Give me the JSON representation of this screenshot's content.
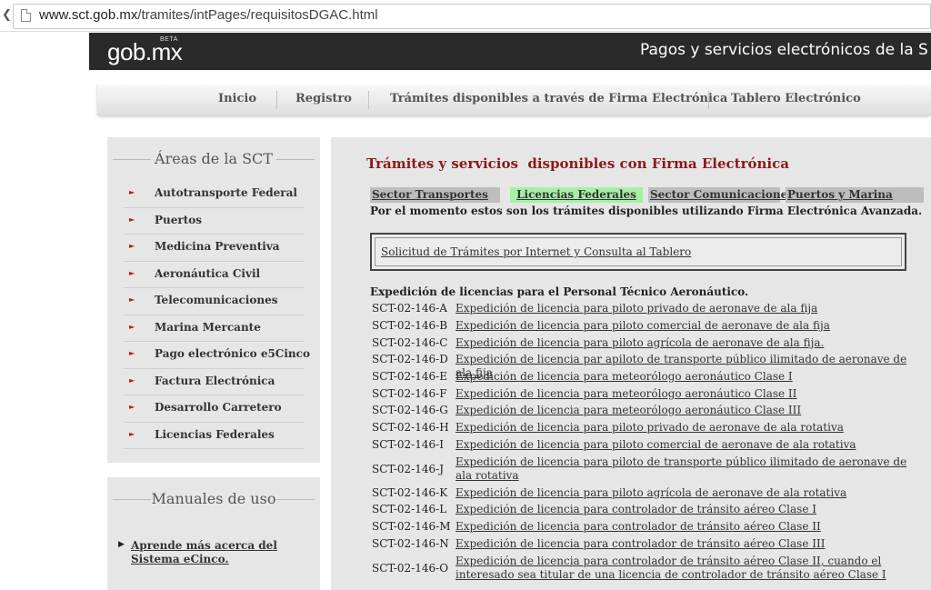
{
  "browser": {
    "url_host": "www.sct.gob.mx",
    "url_path": "/tramites/intPages/requisitosDGAC.html"
  },
  "header": {
    "logo": "gob.mx",
    "logo_badge": "BETA",
    "services_title": "Pagos y servicios electrónicos de la S"
  },
  "nav": {
    "items": [
      "Inicio",
      "Registro",
      "Trámites disponibles a través de Firma Electrónica",
      "Tablero Electrónico"
    ]
  },
  "sidebar": {
    "title": "Áreas de la SCT",
    "items": [
      "Autotransporte Federal",
      "Puertos",
      "Medicina Preventiva",
      "Aeronáutica Civil",
      "Telecomunicaciones",
      "Marina Mercante",
      "Pago electrónico e5Cinco",
      "Factura Electrónica",
      "Desarrollo Carretero",
      "Licencias Federales"
    ]
  },
  "manuals": {
    "title": "Manuales de uso",
    "link": "Aprende más acerca del Sistema eCinco."
  },
  "main": {
    "title": "Trámites y servicios  disponibles con Firma Electrónica",
    "tabs": [
      "Sector Transportes",
      "Licencias Federales",
      "Sector Comunicaciones",
      "Puertos y Marina"
    ],
    "active_tab_color": "#a6f0a6",
    "note": "Por el momento estos son los trámites disponibles utilizando Firma Electrónica Avanzada.",
    "request_link": "Solicitud de Trámites por Internet y Consulta al Tablero",
    "section_title": "Expedición de licencias para el Personal Técnico Aeronáutico.",
    "rows": [
      {
        "code": "SCT-02-146-A",
        "desc": "Expedición de licencia para piloto privado de aeronave de ala fija"
      },
      {
        "code": "SCT-02-146-B",
        "desc": "Expedición de licencia para piloto comercial de aeronave de ala fija"
      },
      {
        "code": "SCT-02-146-C",
        "desc": "Expedición de licencia para piloto agrícola de aeronave de ala fija."
      },
      {
        "code": "SCT-02-146-D",
        "desc": "Expedición de licencia par apiloto de transporte público ilimitado de aeronave de ala fija"
      },
      {
        "code": "SCT-02-146-E",
        "desc": "Expedición de licencia para meteorólogo aeronáutico Clase I"
      },
      {
        "code": "SCT-02-146-F",
        "desc": "Expedición de licencia para meteorólogo aeronáutico Clase II"
      },
      {
        "code": "SCT-02-146-G",
        "desc": "Expedición de licencia para meteorólogo aeronáutico Clase III"
      },
      {
        "code": "SCT-02-146-H",
        "desc": "Expedición de licencia para piloto privado de aeronave de ala rotativa"
      },
      {
        "code": "SCT-02-146-I",
        "desc": "Expedición de licencia para piloto comercial de aeronave de ala rotativa"
      },
      {
        "code": "SCT-02-146-J",
        "desc": "Expedición de licencia para piloto de transporte público ilimitado de aeronave de ala rotativa"
      },
      {
        "code": "SCT-02-146-K",
        "desc": "Expedición de licencia para piloto agrícola de aeronave de ala rotativa"
      },
      {
        "code": "SCT-02-146-L",
        "desc": "Expedición de licencia para controlador de tránsito aéreo Clase I"
      },
      {
        "code": "SCT-02-146-M",
        "desc": "Expedición de licencia para controlador de tránsito aéreo Clase II"
      },
      {
        "code": "SCT-02-146-N",
        "desc": "Expedición de licencia para controlador de tránsito aéreo Clase III"
      },
      {
        "code": "SCT-02-146-O",
        "desc": "Expedición de licencia para controlador de tránsito aéreo Clase II, cuando el interesado sea titular de una licencia de controlador de tránsito aéreo Clase I"
      }
    ]
  }
}
